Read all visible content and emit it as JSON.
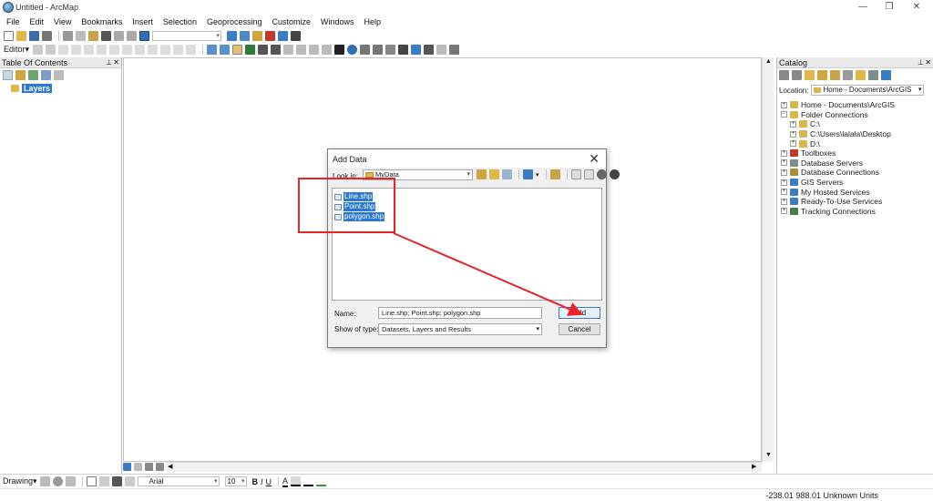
{
  "window": {
    "title": "Untitled - ArcMap",
    "controls": {
      "minimize": "—",
      "restore": "❐",
      "close": "✕"
    }
  },
  "menu": [
    "File",
    "Edit",
    "View",
    "Bookmarks",
    "Insert",
    "Selection",
    "Geoprocessing",
    "Customize",
    "Windows",
    "Help"
  ],
  "editor_toolbar": {
    "label": "Editor▾"
  },
  "toc": {
    "title": "Table Of Contents",
    "layers_label": "Layers"
  },
  "catalog": {
    "title": "Catalog",
    "location_label": "Location:",
    "location_value": "Home - Documents\\ArcGIS",
    "tree": [
      {
        "label": "Home - Documents\\ArcGIS",
        "toggle": "+",
        "icon": "home-folder-icon",
        "color": "#d9b64b",
        "indent": 0
      },
      {
        "label": "Folder Connections",
        "toggle": "−",
        "icon": "folder-connections-icon",
        "color": "#d9b64b",
        "indent": 0
      },
      {
        "label": "C:\\",
        "toggle": "+",
        "icon": "folder-icon",
        "color": "#d9b64b",
        "indent": 1
      },
      {
        "label": "C:\\Users\\lalala\\Desktop",
        "toggle": "+",
        "icon": "folder-icon",
        "color": "#d9b64b",
        "indent": 1
      },
      {
        "label": "D:\\",
        "toggle": "+",
        "icon": "folder-icon",
        "color": "#d9b64b",
        "indent": 1
      },
      {
        "label": "Toolboxes",
        "toggle": "+",
        "icon": "toolbox-icon",
        "color": "#c0392b",
        "indent": 0
      },
      {
        "label": "Database Servers",
        "toggle": "+",
        "icon": "database-server-icon",
        "color": "#7f8c8d",
        "indent": 0
      },
      {
        "label": "Database Connections",
        "toggle": "+",
        "icon": "database-connection-icon",
        "color": "#b08d3a",
        "indent": 0
      },
      {
        "label": "GIS Servers",
        "toggle": "+",
        "icon": "gis-server-icon",
        "color": "#3b7dc4",
        "indent": 0
      },
      {
        "label": "My Hosted Services",
        "toggle": "+",
        "icon": "hosted-services-icon",
        "color": "#3b7dc4",
        "indent": 0
      },
      {
        "label": "Ready-To-Use Services",
        "toggle": "+",
        "icon": "ready-services-icon",
        "color": "#3b7dc4",
        "indent": 0
      },
      {
        "label": "Tracking Connections",
        "toggle": "+",
        "icon": "tracking-icon",
        "color": "#4a7a4a",
        "indent": 0
      }
    ]
  },
  "dialog": {
    "title": "Add Data",
    "close_glyph": "✕",
    "look_in_label": "Look in:",
    "look_in_value": "MyData",
    "files": [
      "Line.shp",
      "Point.shp",
      "polygon.shp"
    ],
    "name_label": "Name:",
    "name_value": "Line.shp; Point.shp; polygon.shp",
    "type_label": "Show of type:",
    "type_value": "Datasets, Layers and Results",
    "add_label": "Add",
    "cancel_label": "Cancel"
  },
  "drawing_toolbar": {
    "label": "Drawing▾",
    "font_name": "Arial",
    "font_size": "10",
    "bold": "B",
    "italic": "I",
    "underline": "U",
    "font_color": "A"
  },
  "status": {
    "coords": "-238.01  988.01 Unknown Units"
  },
  "colors": {
    "selection": "#2a78d1",
    "annotation": "#e8232a"
  }
}
